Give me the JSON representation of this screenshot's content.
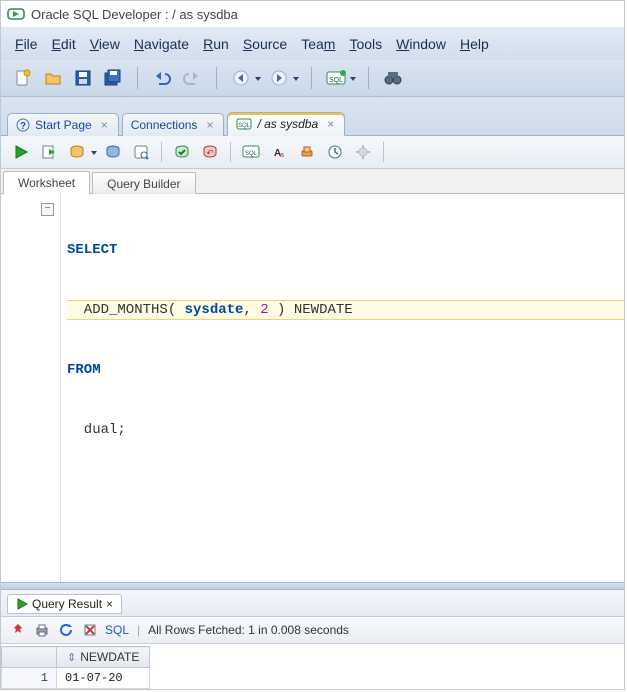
{
  "title": "Oracle SQL Developer : / as sysdba",
  "menu": {
    "file": "File",
    "edit": "Edit",
    "view": "View",
    "navigate": "Navigate",
    "run": "Run",
    "source": "Source",
    "team": "Team",
    "tools": "Tools",
    "window": "Window",
    "help": "Help"
  },
  "tabs": {
    "start": "Start Page",
    "connections": "Connections",
    "active": "/ as sysdba"
  },
  "subtabs": {
    "worksheet": "Worksheet",
    "querybuilder": "Query Builder"
  },
  "sql": {
    "kw_select": "SELECT",
    "line2_a": "  ADD_MONTHS( ",
    "line2_sysdate": "sysdate",
    "line2_b": ", ",
    "line2_num": "2",
    "line2_c": " ) NEWDATE",
    "kw_from": "FROM",
    "line4": "  dual;"
  },
  "result": {
    "tab_label": "Query Result",
    "sql_link": "SQL",
    "status": "All Rows Fetched: 1 in 0.008 seconds",
    "columns": [
      "NEWDATE"
    ],
    "rows": [
      {
        "n": "1",
        "NEWDATE": "01-07-20"
      }
    ]
  }
}
